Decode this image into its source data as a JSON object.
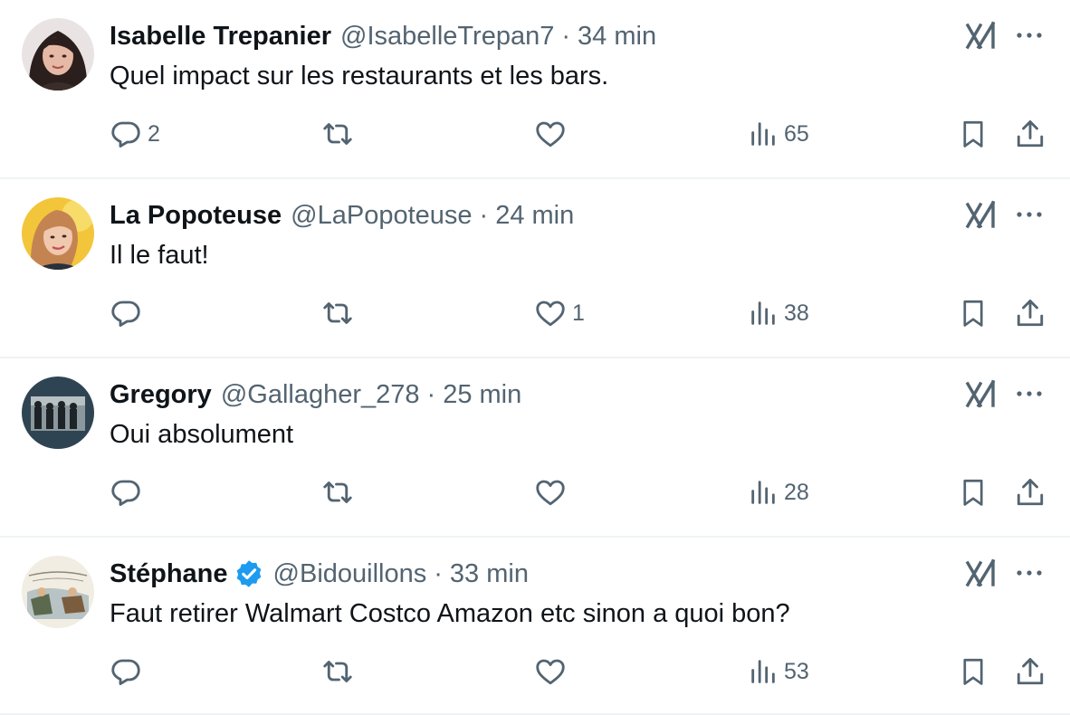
{
  "colors": {
    "text_primary": "#0f1419",
    "text_secondary": "#536471",
    "divider": "#eff3f4",
    "verified_blue": "#1d9bf0"
  },
  "tweets": [
    {
      "name": "Isabelle Trepanier",
      "handle": "@IsabelleTrepan7",
      "separator": "·",
      "time": "34 min",
      "verified": false,
      "text": "Quel impact sur les restaurants et les bars.",
      "reply_count": "2",
      "retweet_count": "",
      "like_count": "",
      "view_count": "65",
      "avatar_icon": "avatar-woman-dark-hair"
    },
    {
      "name": "La Popoteuse",
      "handle": "@LaPopoteuse",
      "separator": "·",
      "time": "24 min",
      "verified": false,
      "text": "Il le faut!",
      "reply_count": "",
      "retweet_count": "",
      "like_count": "1",
      "view_count": "38",
      "avatar_icon": "avatar-woman-yellow-bg"
    },
    {
      "name": "Gregory",
      "handle": "@Gallagher_278",
      "separator": "·",
      "time": "25 min",
      "verified": false,
      "text": "Oui absolument",
      "reply_count": "",
      "retweet_count": "",
      "like_count": "",
      "view_count": "28",
      "avatar_icon": "avatar-band-photo"
    },
    {
      "name": "Stéphane",
      "handle": "@Bidouillons",
      "separator": "·",
      "time": "33 min",
      "verified": true,
      "text": "Faut retirer Walmart Costco Amazon etc sinon a quoi bon?",
      "reply_count": "",
      "retweet_count": "",
      "like_count": "",
      "view_count": "53",
      "avatar_icon": "avatar-cartoon-drawing"
    }
  ],
  "icons": {
    "reply": "reply-icon",
    "retweet": "retweet-icon",
    "like": "heart-icon",
    "views": "views-icon",
    "bookmark": "bookmark-icon",
    "share": "share-icon",
    "grok": "grok-icon",
    "more": "more-icon",
    "verified": "verified-badge-icon"
  }
}
